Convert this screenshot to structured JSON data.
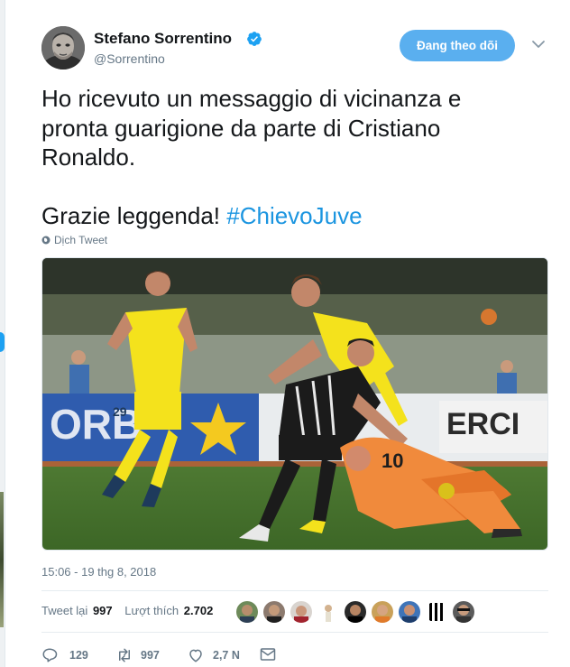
{
  "author": {
    "display_name": "Stefano Sorrentino",
    "handle": "@Sorrentino",
    "verified_icon": "verified-badge-icon",
    "follow_button_label": "Đang theo dõi"
  },
  "tweet": {
    "text_line1": "Ho ricevuto un messaggio di vicinanza e\npronta guarigione da parte di Cristiano\nRonaldo.",
    "text_line2_prefix": "Grazie leggenda! ",
    "hashtag": "#ChievoJuve",
    "translate_label": "Dịch Tweet",
    "timestamp": "15:06 - 19 thg 8, 2018"
  },
  "stats": {
    "retweets_label": "Tweet lại",
    "retweets_value": "997",
    "likes_label": "Lượt thích",
    "likes_value": "2.702"
  },
  "actions": {
    "reply_count": "129",
    "retweet_count": "997",
    "like_count": "2,7 N"
  },
  "colors": {
    "accent": "#1da1f2",
    "hashtag": "#1b95e0",
    "follow_button": "#5aafef"
  }
}
